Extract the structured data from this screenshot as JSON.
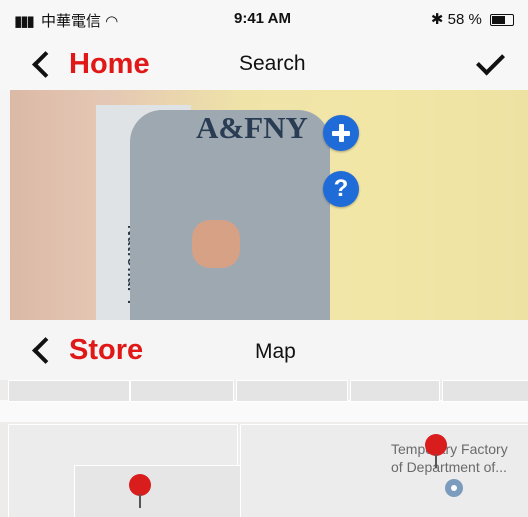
{
  "status": {
    "carrier": "中華電信",
    "time": "9:41 AM",
    "battery": "58 %"
  },
  "navbar": {
    "back_label": "Home",
    "title": "Search"
  },
  "camera": {
    "shirt_logo": "A&FNY",
    "sign_text": "National T"
  },
  "subnav": {
    "back_label": "Store",
    "title": "Map"
  },
  "map": {
    "poi_label_line1": "Temporary Factory",
    "poi_label_line2": "of Department of..."
  },
  "colors": {
    "accent_red": "#e01818",
    "fab_blue": "#1f6cd9",
    "pin_red": "#d91d1d"
  }
}
